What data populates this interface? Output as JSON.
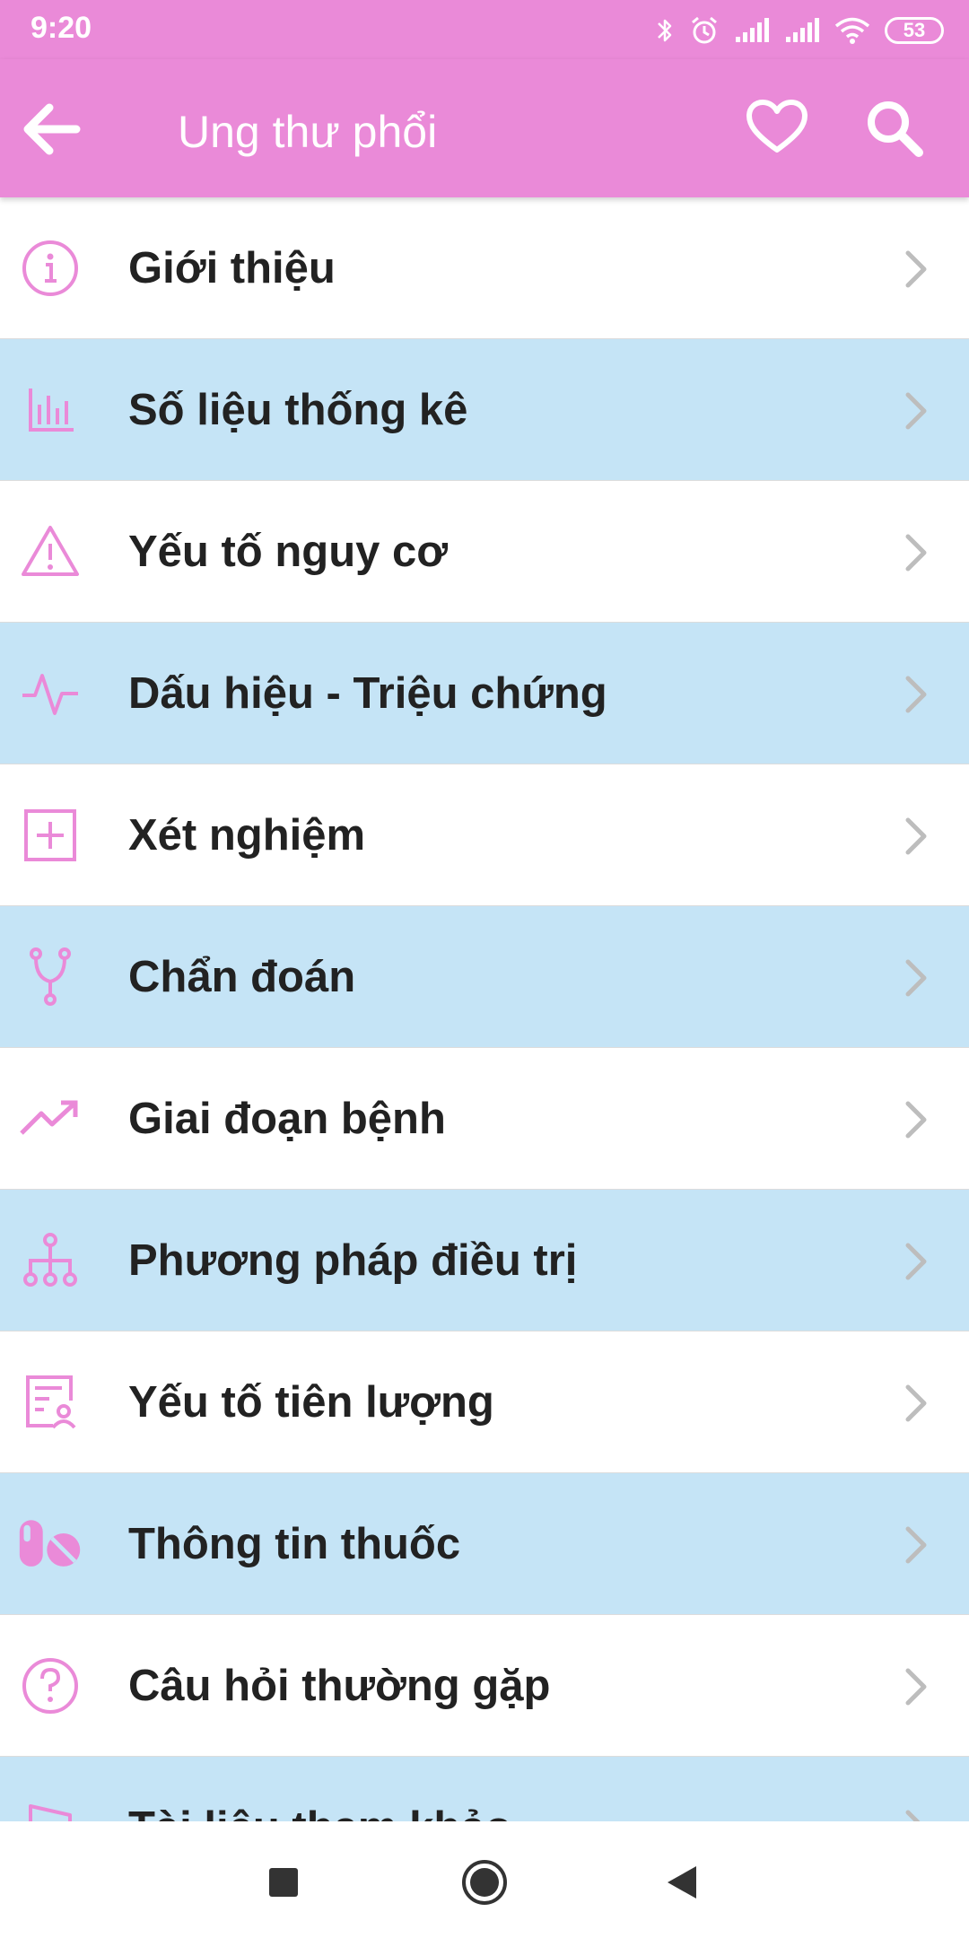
{
  "status": {
    "time": "9:20",
    "battery": "53",
    "icons": [
      "bluetooth-icon",
      "alarm-icon",
      "signal-icon",
      "signal-icon",
      "wifi-icon",
      "battery-icon"
    ]
  },
  "appbar": {
    "title": "Ung thư phổi",
    "back_icon": "arrow-left-icon",
    "favorite_icon": "heart-icon",
    "search_icon": "search-icon"
  },
  "menu": {
    "items": [
      {
        "label": "Giới thiệu",
        "icon": "info-icon"
      },
      {
        "label": "Số liệu thống kê",
        "icon": "bar-chart-icon"
      },
      {
        "label": "Yếu tố nguy cơ",
        "icon": "warning-icon"
      },
      {
        "label": "Dấu hiệu - Triệu chứng",
        "icon": "pulse-icon"
      },
      {
        "label": "Xét nghiệm",
        "icon": "plus-square-icon"
      },
      {
        "label": "Chẩn đoán",
        "icon": "branch-icon"
      },
      {
        "label": "Giai đoạn bệnh",
        "icon": "trending-up-icon"
      },
      {
        "label": "Phương pháp điều trị",
        "icon": "hierarchy-icon"
      },
      {
        "label": "Yếu tố tiên lượng",
        "icon": "user-report-icon"
      },
      {
        "label": "Thông tin thuốc",
        "icon": "pills-icon"
      },
      {
        "label": "Câu hỏi thường gặp",
        "icon": "question-icon"
      },
      {
        "label": "Tài liệu tham khảo",
        "icon": "bookmark-icon"
      }
    ]
  },
  "colors": {
    "accent": "#EA8AD8",
    "row_alt": "#C5E4F6",
    "text": "#222222",
    "chevron": "#bdbdbd"
  },
  "navbar": {
    "icons": [
      "square-icon",
      "circle-icon",
      "triangle-back-icon"
    ]
  }
}
